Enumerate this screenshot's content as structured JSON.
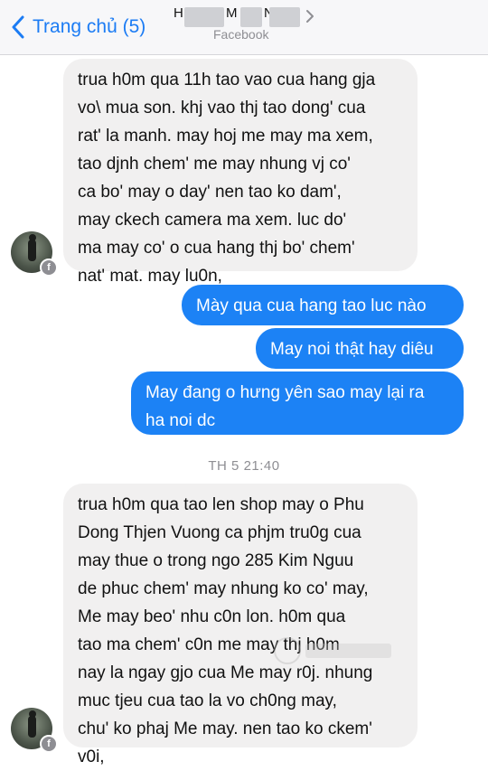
{
  "header": {
    "back_label": "Trang chủ (5)",
    "name_visible": [
      "H",
      "M",
      "N"
    ],
    "subtitle": "Facebook"
  },
  "messages": [
    {
      "from": "them",
      "text": "trua h0m qua 11h tao vao cua hang gja\nvo\\ mua son.  khj vao thj tao dong' cua\nrat' la manh. may hoj me may ma xem,\ntao djnh chem' me may nhung vj co'\nca bo' may o day' nen tao ko dam',\nmay ckech camera ma xem. luc do'\nma may co' o cua hang thj bo' chem'\nnat' mat. may lu0n,"
    },
    {
      "from": "me",
      "text": "Mày qua cua hang tao luc nào"
    },
    {
      "from": "me",
      "text": "May noi thật hay diêu"
    },
    {
      "from": "me",
      "text": "May đang o hưng yên sao may lại ra\nha noi dc"
    },
    {
      "from": "them",
      "text": "trua h0m qua tao len shop may o Phu\nDong Thjen Vuong ca phjm tru0g cua\nmay thue o trong ngo 285 Kim Nguu\nde phuc chem' may nhung ko co' may,\nMe may beo' nhu c0n lon. h0m qua\ntao ma chem' c0n me may thj h0m\nnay la ngay gjo cua Me may r0j. nhung\nmuc tjeu cua tao la vo ch0ng may,\nchu' ko phaj Me may. nen tao ko ckem'\nv0i,"
    }
  ],
  "timestamp": "TH 5 21:40",
  "icons": {
    "back": "chevron-left-icon",
    "contact": "chevron-right-icon",
    "badge": "facebook-badge-icon"
  },
  "colors": {
    "accent": "#1c7cf4",
    "outgoing_bubble": "#1c82f5",
    "incoming_bubble": "#f1f0f0"
  }
}
